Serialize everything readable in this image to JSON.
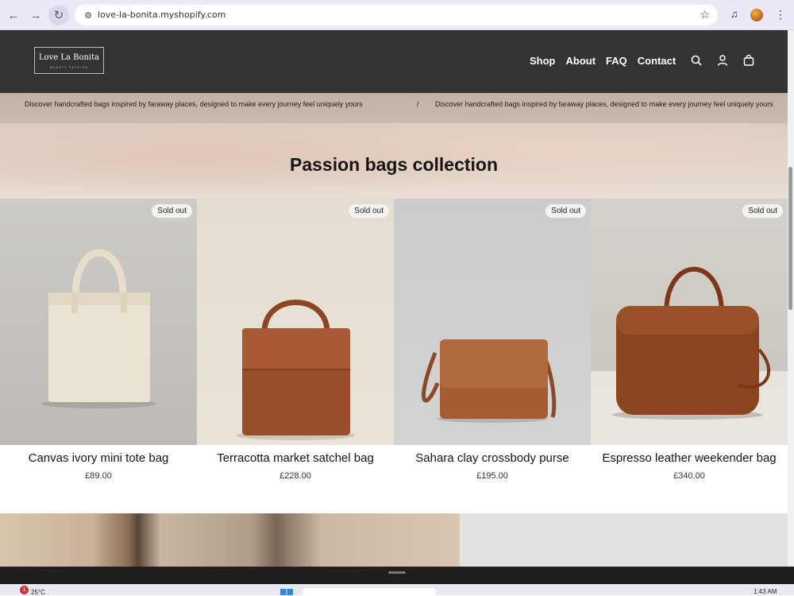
{
  "browser": {
    "url": "love-la-bonita.myshopify.com",
    "icons": [
      "back-icon",
      "forward-icon",
      "reload-icon",
      "site-info-icon",
      "star-icon",
      "media-icon",
      "menu-dots-icon"
    ]
  },
  "header": {
    "logo_name": "Love La Bonita",
    "logo_tagline": "BEAUTY PASSION",
    "nav": [
      "Shop",
      "About",
      "FAQ",
      "Contact"
    ],
    "icons": [
      "search-icon",
      "account-icon",
      "cart-icon"
    ]
  },
  "announcement": {
    "text": "Discover handcrafted bags inspired by faraway places, designed to make every journey feel uniquely yours",
    "separator": "/"
  },
  "collection": {
    "title": "Passion bags collection",
    "products": [
      {
        "name": "Canvas ivory mini tote bag",
        "price": "£89.00",
        "badge": "Sold out"
      },
      {
        "name": "Terracotta market satchel bag",
        "price": "£228.00",
        "badge": "Sold out"
      },
      {
        "name": "Sahara clay crossbody purse",
        "price": "£195.00",
        "badge": "Sold out"
      },
      {
        "name": "Espresso leather weekender bag",
        "price": "£340.00",
        "badge": "Sold out"
      }
    ]
  },
  "taskbar": {
    "weather": "25°C",
    "notification_count": "1",
    "time": "1:43 AM"
  },
  "colors": {
    "header_bg": "#333333",
    "chrome_bg": "#ece8f6",
    "accent_leather": "#8f4a28"
  }
}
